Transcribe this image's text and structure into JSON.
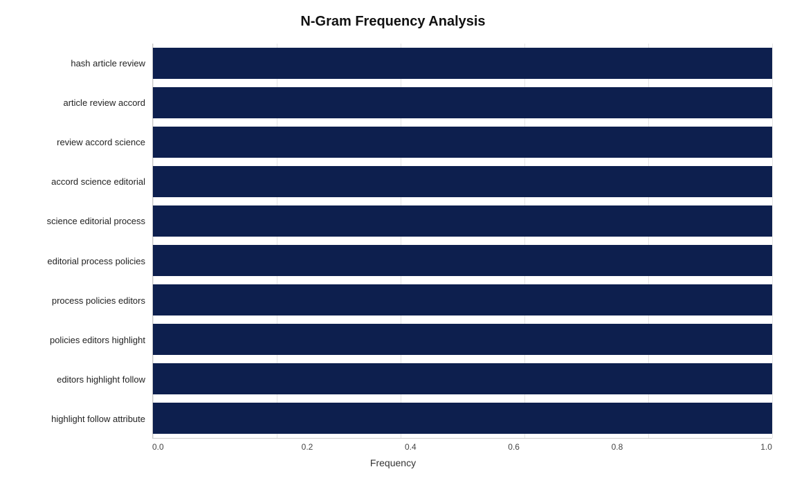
{
  "chart": {
    "title": "N-Gram Frequency Analysis",
    "x_label": "Frequency",
    "x_ticks": [
      "0.0",
      "0.2",
      "0.4",
      "0.6",
      "0.8",
      "1.0"
    ],
    "bar_color": "#0d1f4e",
    "bars": [
      {
        "label": "hash article review",
        "value": 1.0
      },
      {
        "label": "article review accord",
        "value": 1.0
      },
      {
        "label": "review accord science",
        "value": 1.0
      },
      {
        "label": "accord science editorial",
        "value": 1.0
      },
      {
        "label": "science editorial process",
        "value": 1.0
      },
      {
        "label": "editorial process policies",
        "value": 1.0
      },
      {
        "label": "process policies editors",
        "value": 1.0
      },
      {
        "label": "policies editors highlight",
        "value": 1.0
      },
      {
        "label": "editors highlight follow",
        "value": 1.0
      },
      {
        "label": "highlight follow attribute",
        "value": 1.0
      }
    ]
  }
}
